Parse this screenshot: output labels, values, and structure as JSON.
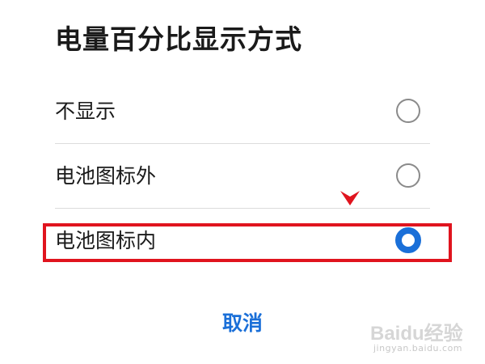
{
  "dialog": {
    "title": "电量百分比显示方式",
    "options": [
      {
        "label": "不显示",
        "selected": false
      },
      {
        "label": "电池图标外",
        "selected": false
      },
      {
        "label": "电池图标内",
        "selected": true
      }
    ],
    "cancel_label": "取消"
  },
  "colors": {
    "accent": "#1a6fd8",
    "highlight": "#e0141e",
    "text": "#1a1a1a",
    "divider": "#dcdcdc"
  },
  "watermark": {
    "main": "Baidu经验",
    "sub": "jingyan.baidu.com"
  }
}
